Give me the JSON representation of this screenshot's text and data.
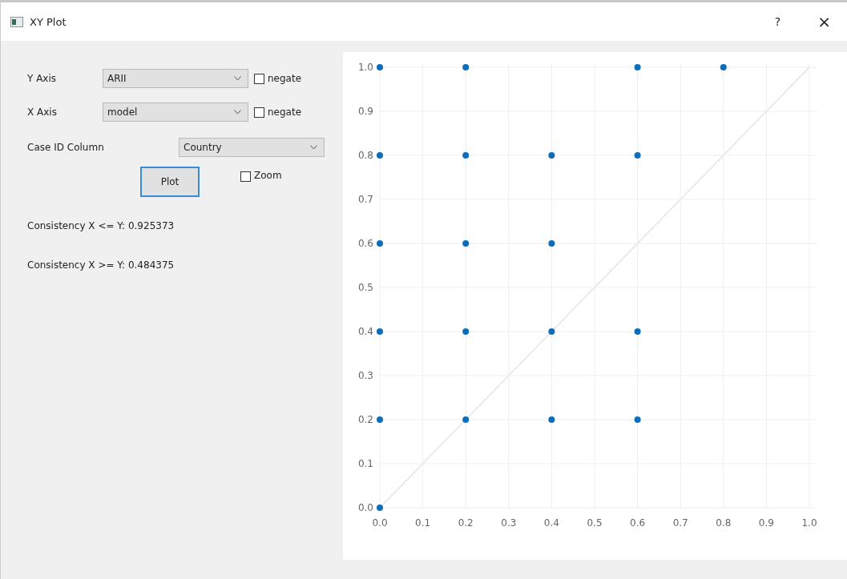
{
  "window": {
    "title": "XY Plot",
    "help": "?",
    "close": "×"
  },
  "y_axis": {
    "label": "Y Axis",
    "value": "ARII",
    "negate_label": "negate",
    "negate_checked": false
  },
  "x_axis": {
    "label": "X Axis",
    "value": "model",
    "negate_label": "negate",
    "negate_checked": false
  },
  "case_id": {
    "label": "Case ID Column",
    "value": "Country"
  },
  "plot_button": "Plot",
  "zoom": {
    "label": "Zoom",
    "checked": false
  },
  "results": [
    "Consistency X <= Y: 0.925373",
    "Consistency X >= Y: 0.484375"
  ],
  "chart": {
    "chart_data": {
      "type": "scatter",
      "x": [
        0,
        0.2,
        0.6,
        0.8,
        0,
        0.2,
        0.4,
        0.6,
        0,
        0.2,
        0.4,
        0,
        0.2,
        0.4,
        0.6,
        0,
        0.2,
        0.4,
        0.6,
        0
      ],
      "grid": true,
      "series": [
        {
          "color": "#0a6ebd",
          "values": [
            1,
            1,
            1,
            1,
            0.8,
            0.8,
            0.8,
            0.8,
            0.6,
            0.6,
            0.6,
            0.4,
            0.4,
            0.4,
            0.4,
            0.2,
            0.2,
            0.2,
            0.2,
            0
          ]
        }
      ],
      "xlim": [
        0,
        1
      ],
      "ylim": [
        0,
        1
      ],
      "xticks": [
        {
          "value": 0,
          "label": "0.0"
        },
        {
          "value": 0.1,
          "label": "0.1"
        },
        {
          "value": 0.2,
          "label": "0.2"
        },
        {
          "value": 0.3,
          "label": "0.3"
        },
        {
          "value": 0.4,
          "label": "0.4"
        },
        {
          "value": 0.5,
          "label": "0.5"
        },
        {
          "value": 0.6,
          "label": "0.6"
        },
        {
          "value": 0.7,
          "label": "0.7"
        },
        {
          "value": 0.8,
          "label": "0.8"
        },
        {
          "value": 0.9,
          "label": "0.9"
        },
        {
          "value": 1,
          "label": "1.0"
        }
      ],
      "yticks": [
        {
          "value": 0,
          "label": "0.0"
        },
        {
          "value": 0.1,
          "label": "0.1"
        },
        {
          "value": 0.2,
          "label": "0.2"
        },
        {
          "value": 0.3,
          "label": "0.3"
        },
        {
          "value": 0.4,
          "label": "0.4"
        },
        {
          "value": 0.5,
          "label": "0.5"
        },
        {
          "value": 0.6,
          "label": "0.6"
        },
        {
          "value": 0.7,
          "label": "0.7"
        },
        {
          "value": 0.8,
          "label": "0.8"
        },
        {
          "value": 0.9,
          "label": "0.9"
        },
        {
          "value": 1,
          "label": "1.0"
        }
      ]
    }
  }
}
